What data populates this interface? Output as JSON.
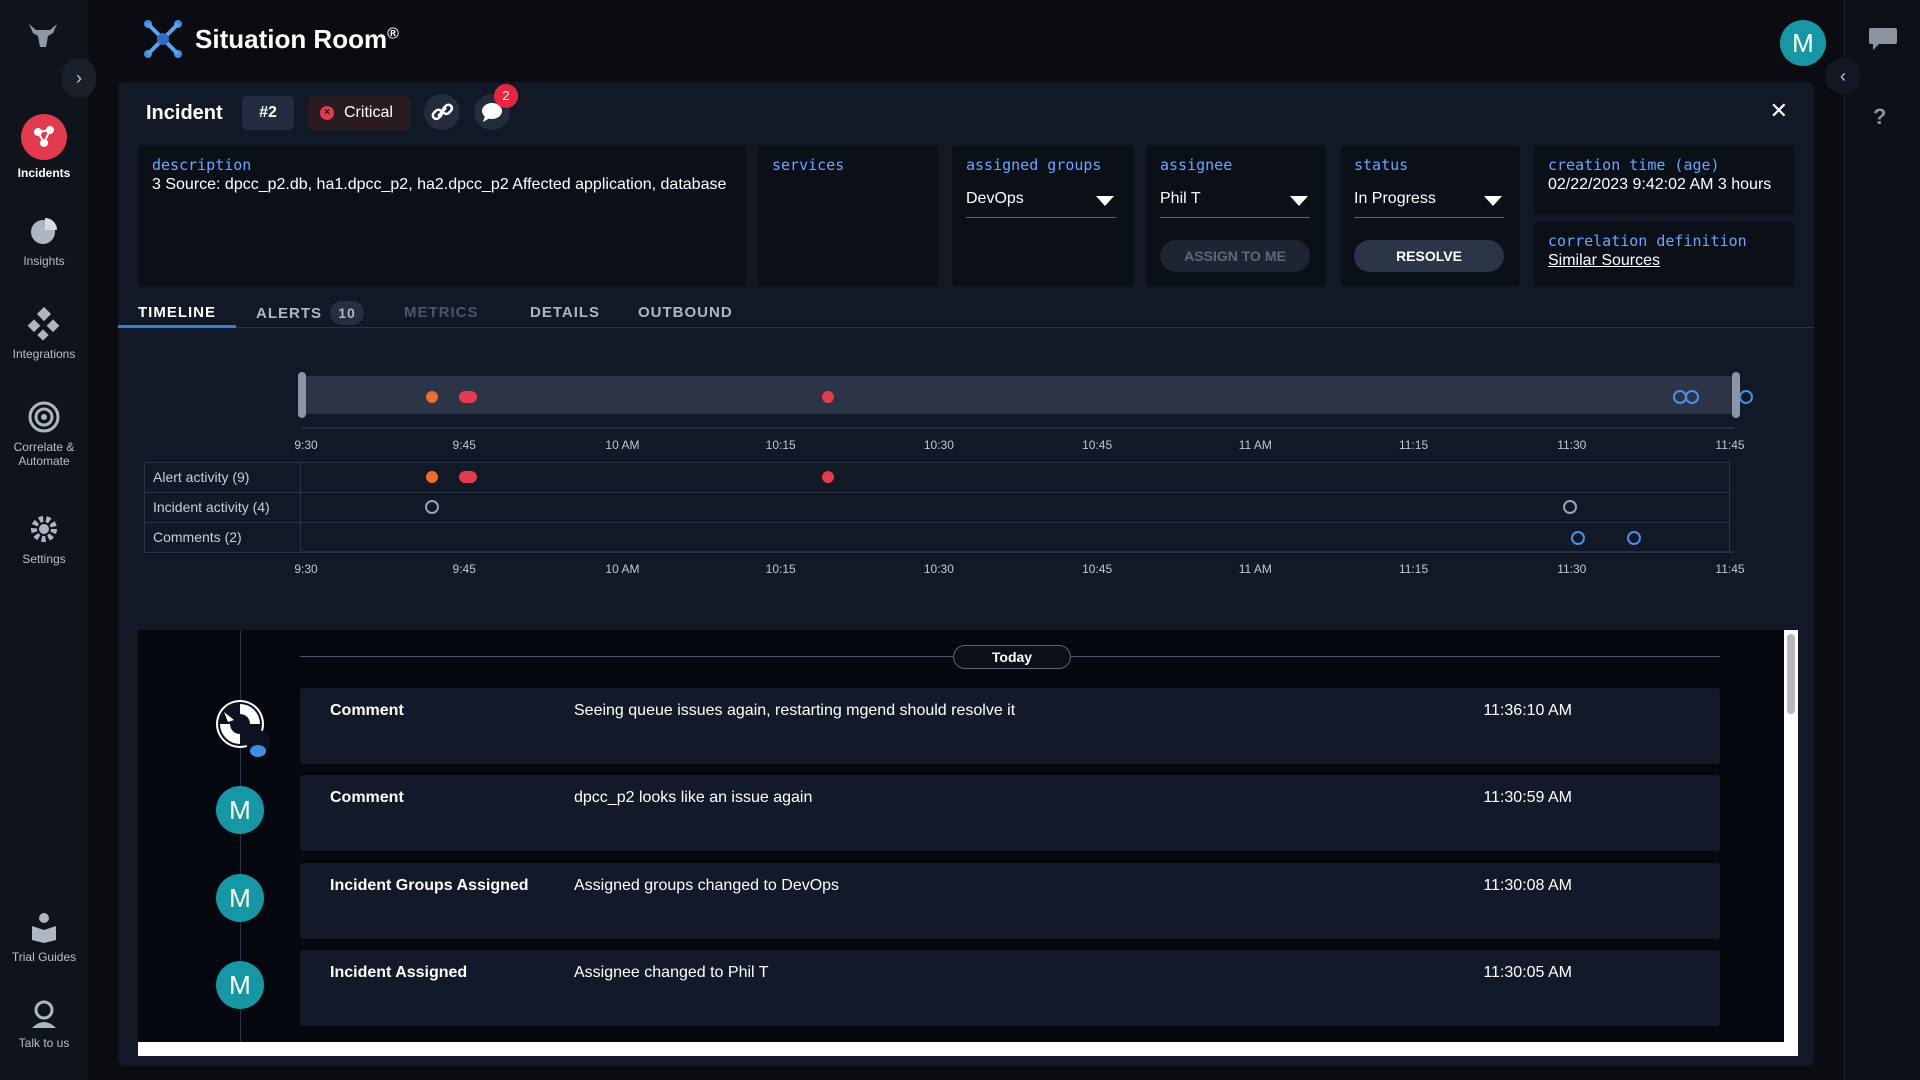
{
  "nav": {
    "items": [
      {
        "label": "Incidents",
        "icon": "incidents-icon"
      },
      {
        "label": "Insights",
        "icon": "pie-chart-icon"
      },
      {
        "label": "Integrations",
        "icon": "integrations-icon"
      },
      {
        "label": "Correlate &",
        "label2": "Automate",
        "icon": "target-icon"
      },
      {
        "label": "Settings",
        "icon": "gear-icon"
      },
      {
        "label": "Trial Guides",
        "icon": "book-icon"
      },
      {
        "label": "Talk to us",
        "icon": "support-icon"
      }
    ]
  },
  "header": {
    "title": "Situation Room",
    "title_mark": "®",
    "avatar_initial": "M"
  },
  "incident": {
    "title": "Incident",
    "number": "#2",
    "severity": "Critical",
    "comment_count": "2",
    "fields": {
      "description_label": "description",
      "description": "3 Source: dpcc_p2.db, ha1.dpcc_p2, ha2.dpcc_p2 Affected application, database",
      "services_label": "services",
      "groups_label": "assigned groups",
      "groups_value": "DevOps",
      "assignee_label": "assignee",
      "assignee_value": "Phil T",
      "assign_to_me": "ASSIGN TO ME",
      "status_label": "status",
      "status_value": "In Progress",
      "resolve": "RESOLVE",
      "creation_label": "creation time (age)",
      "creation_value": "02/22/2023 9:42:02 AM 3 hours",
      "correlation_label": "correlation definition",
      "correlation_value": "Similar Sources"
    }
  },
  "tabs": [
    {
      "label": "TIMELINE",
      "state": "active"
    },
    {
      "label": "ALERTS",
      "count": "10",
      "state": "normal"
    },
    {
      "label": "METRICS",
      "state": "disabled"
    },
    {
      "label": "DETAILS",
      "state": "normal"
    },
    {
      "label": "OUTBOUND",
      "state": "normal"
    }
  ],
  "timeline": {
    "ticks": [
      "9:30",
      "9:45",
      "10 AM",
      "10:15",
      "10:30",
      "10:45",
      "11 AM",
      "11:15",
      "11:30",
      "11:45"
    ],
    "rows": [
      {
        "label": "Alert activity (9)"
      },
      {
        "label": "Incident activity (4)"
      },
      {
        "label": "Comments (2)"
      }
    ],
    "colors": {
      "alert_orange": "#f06a2a",
      "alert_red": "#e23b4e",
      "comment_blue": "#4a8fe8",
      "incident_gray": "#9aa3b2"
    }
  },
  "feed": {
    "day_label": "Today",
    "entries": [
      {
        "type": "Comment",
        "text": "Seeing queue issues again, restarting mgend should resolve it",
        "time": "11:36:10 AM",
        "avatar": "bot"
      },
      {
        "type": "Comment",
        "text": "dpcc_p2 looks like an issue again",
        "time": "11:30:59 AM",
        "avatar": "M"
      },
      {
        "type": "Incident Groups Assigned",
        "text": "Assigned groups changed to DevOps",
        "time": "11:30:08 AM",
        "avatar": "M"
      },
      {
        "type": "Incident Assigned",
        "text": "Assignee changed to Phil T",
        "time": "11:30:05 AM",
        "avatar": "M"
      }
    ]
  }
}
